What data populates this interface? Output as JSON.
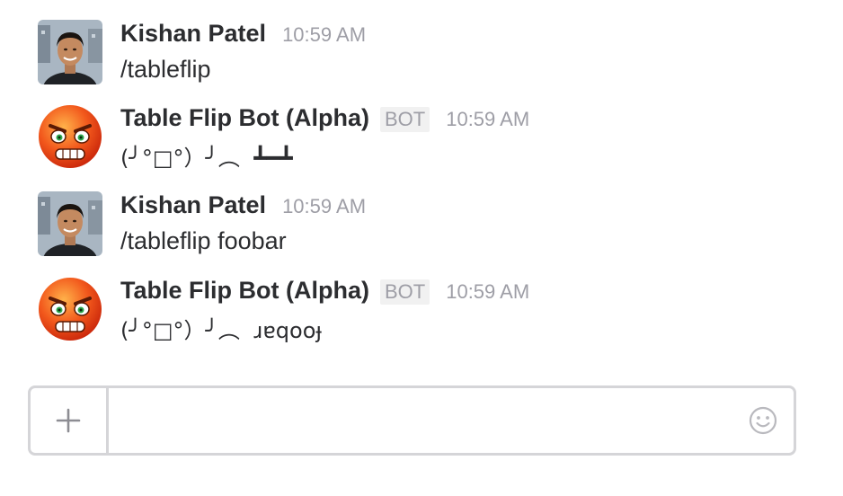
{
  "messages": [
    {
      "sender": "Kishan Patel",
      "time": "10:59 AM",
      "text": "/tableflip",
      "is_bot": false,
      "avatar": "user-photo-avatar"
    },
    {
      "sender": "Table Flip Bot (Alpha)",
      "badge": "BOT",
      "time": "10:59 AM",
      "face": "(╯°□°）╯︵",
      "flipped": "┻━┻",
      "is_bot": true,
      "avatar": "angry-face-avatar"
    },
    {
      "sender": "Kishan Patel",
      "time": "10:59 AM",
      "text": "/tableflip foobar",
      "is_bot": false,
      "avatar": "user-photo-avatar"
    },
    {
      "sender": "Table Flip Bot (Alpha)",
      "badge": "BOT",
      "time": "10:59 AM",
      "face": "(╯°□°）╯︵",
      "flipped": "ɹɐqooɟ",
      "is_bot": true,
      "avatar": "angry-face-avatar"
    }
  ],
  "composer": {
    "value": "",
    "plus_icon": "plus-icon",
    "emoji_icon": "smiley-icon"
  },
  "colors": {
    "text": "#2c2d30",
    "muted": "#9e9ea6",
    "border": "#d5d5d8",
    "badge_bg": "#f1f1f1"
  }
}
